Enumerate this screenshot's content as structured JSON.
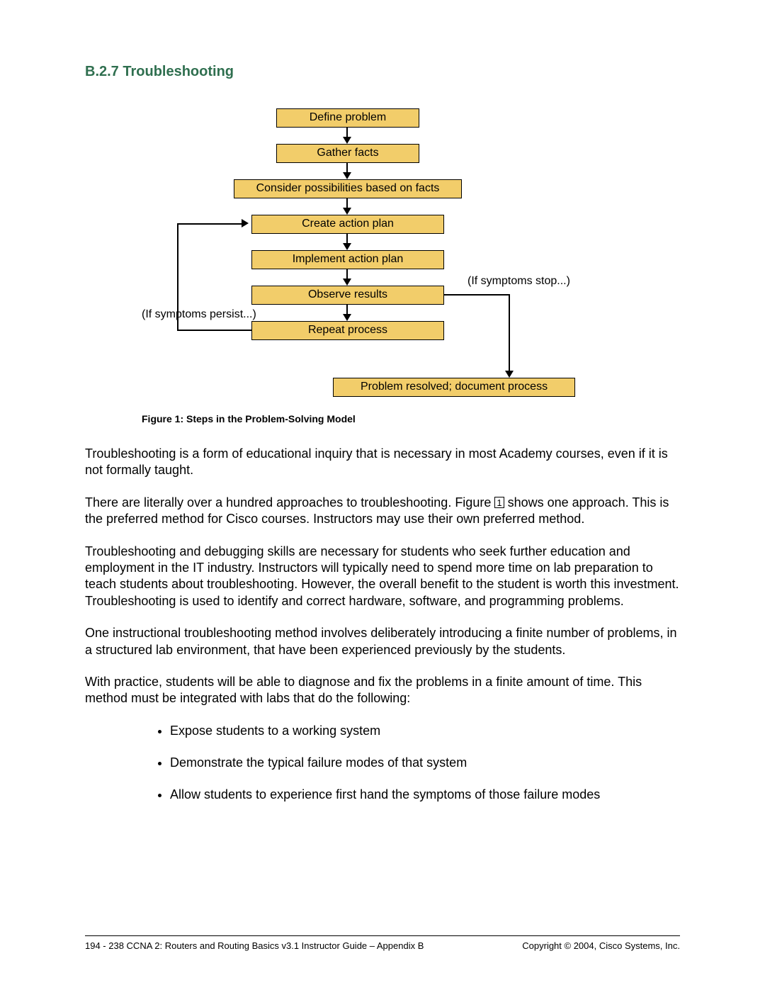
{
  "heading": "B.2.7 Troubleshooting",
  "flowchart": {
    "steps": [
      "Define problem",
      "Gather facts",
      "Consider possibilities based on facts",
      "Create action plan",
      "Implement action plan",
      "Observe results",
      "Repeat process"
    ],
    "final": "Problem resolved; document process",
    "note_stop": "(If symptoms stop...)",
    "note_persist": "(If symptoms persist...)"
  },
  "caption": "Figure 1: Steps in the Problem-Solving Model",
  "paragraphs": {
    "p1": "Troubleshooting is a form of educational inquiry that is necessary in most Academy courses, even if it is not formally taught.",
    "p2a": "There are literally over a hundred approaches to troubleshooting. Figure ",
    "p2_fig": "1",
    "p2b": " shows one approach. This is the preferred method for Cisco courses. Instructors may use their own preferred method.",
    "p3": "Troubleshooting and debugging skills are necessary for students who seek further education and employment in the IT industry. Instructors will typically need to spend more time on lab preparation to teach students about troubleshooting. However, the overall benefit to the student is worth this investment. Troubleshooting is used to identify and correct hardware, software, and programming problems.",
    "p4": "One instructional troubleshooting method involves deliberately introducing a finite number of problems, in a structured lab environment, that have been experienced previously by the students.",
    "p5": "With practice, students will be able to diagnose and fix the problems in a finite amount of time. This method must be integrated with labs that do the following:"
  },
  "bullets": [
    "Expose students to a working system",
    "Demonstrate the typical failure modes of that system",
    "Allow students to experience first hand the symptoms of those failure modes"
  ],
  "footer": {
    "left": "194 - 238    CCNA 2: Routers and Routing Basics v3.1 Instructor Guide – Appendix B",
    "right": "Copyright © 2004, Cisco Systems, Inc."
  }
}
